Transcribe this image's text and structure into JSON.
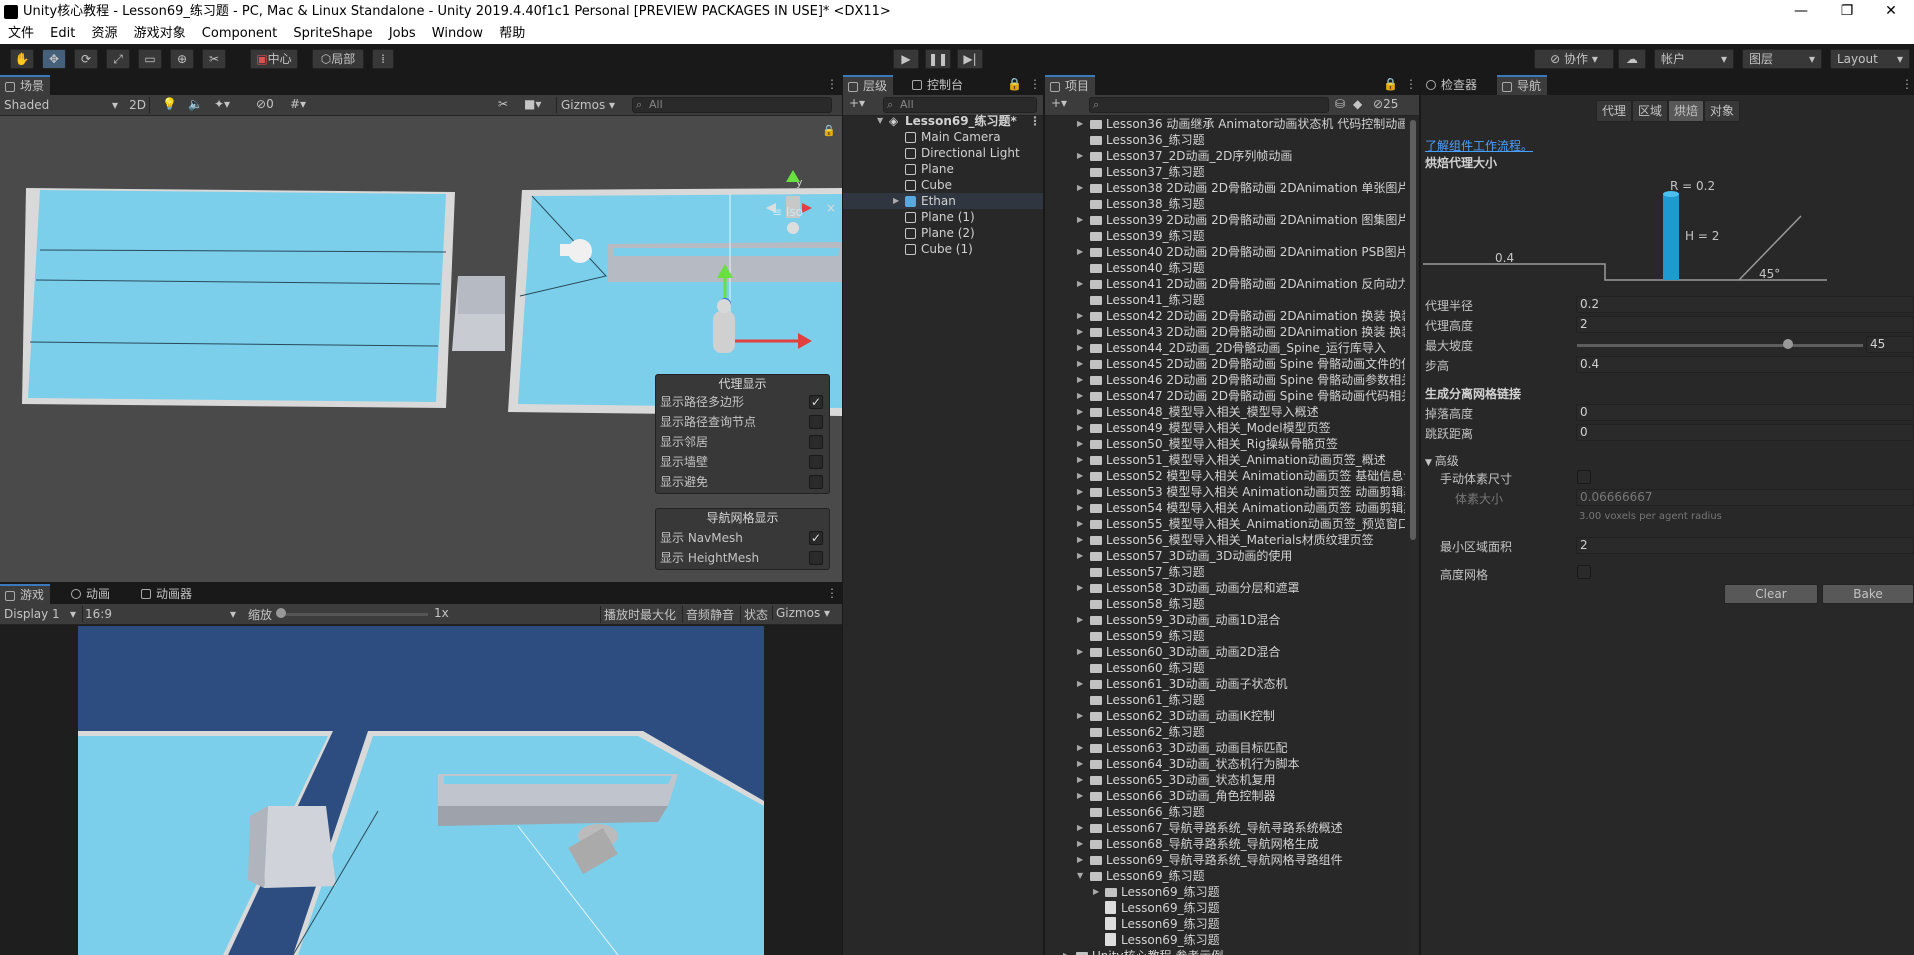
{
  "window": {
    "title": "Unity核心教程 - Lesson69_练习题 - PC, Mac & Linux Standalone - Unity 2019.4.40f1c1 Personal [PREVIEW PACKAGES IN USE]* <DX11>",
    "minimize": "—",
    "maximize": "❐",
    "close": "✕"
  },
  "menu": [
    "文件",
    "Edit",
    "资源",
    "游戏对象",
    "Component",
    "SpriteShape",
    "Jobs",
    "Window",
    "帮助"
  ],
  "toolbar": {
    "center_label": "中心",
    "local_label": "局部",
    "collab_label": "协作",
    "account_label": "帐户",
    "layers_label": "图层",
    "layout_label": "Layout"
  },
  "scene": {
    "tab": "场景",
    "shading": "Shaded",
    "mode2d": "2D",
    "hidden_count": "0",
    "gizmos": "Gizmos",
    "search": "All",
    "persp": "≡ Iso",
    "gizmo_y": "y"
  },
  "agent_overlay": {
    "title": "代理显示",
    "items": [
      {
        "label": "显示路径多边形",
        "checked": true
      },
      {
        "label": "显示路径查询节点",
        "checked": false
      },
      {
        "label": "显示邻居",
        "checked": false
      },
      {
        "label": "显示墙壁",
        "checked": false
      },
      {
        "label": "显示避免",
        "checked": false
      }
    ]
  },
  "navmesh_overlay": {
    "title": "导航网格显示",
    "items": [
      {
        "label": "显示 NavMesh",
        "checked": true
      },
      {
        "label": "显示 HeightMesh",
        "checked": false
      }
    ]
  },
  "game": {
    "tabs": [
      "游戏",
      "动画",
      "动画器"
    ],
    "display": "Display 1",
    "aspect": "16:9",
    "scale_label": "缩放",
    "scale_value": "1x",
    "maximize": "播放时最大化",
    "mute": "音频静音",
    "stats": "状态",
    "gizmos": "Gizmos"
  },
  "hierarchy": {
    "tabs": [
      "层级",
      "控制台"
    ],
    "search": "All",
    "root": "Lesson69_练习题*",
    "items": [
      "Main Camera",
      "Directional Light",
      "Plane",
      "Cube",
      "Ethan",
      "Plane (1)",
      "Plane (2)",
      "Cube (1)"
    ]
  },
  "project": {
    "tab": "项目",
    "hidden_count": "25",
    "items": [
      "Lesson36 动画继承 Animator动画状态机 代码控制动画",
      "Lesson36_练习题",
      "Lesson37_2D动画_2D序列帧动画",
      "Lesson37_练习题",
      "Lesson38 2D动画 2D骨骼动画 2DAnimation 单张图片",
      "Lesson38_练习题",
      "Lesson39 2D动画 2D骨骼动画 2DAnimation 图集图片",
      "Lesson39_练习题",
      "Lesson40 2D动画 2D骨骼动画 2DAnimation PSB图片",
      "Lesson40_练习题",
      "Lesson41 2D动画 2D骨骼动画 2DAnimation 反向动力",
      "Lesson41_练习题",
      "Lesson42 2D动画 2D骨骼动画 2DAnimation 换装 换装",
      "Lesson43 2D动画 2D骨骼动画 2DAnimation 换装 换装",
      "Lesson44_2D动画_2D骨骼动画_Spine_运行库导入",
      "Lesson45 2D动画 2D骨骼动画 Spine 骨骼动画文件的使",
      "Lesson46 2D动画 2D骨骼动画 Spine 骨骼动画参数相关",
      "Lesson47 2D动画 2D骨骼动画 Spine 骨骼动画代码相关",
      "Lesson48_模型导入相关_模型导入概述",
      "Lesson49_模型导入相关_Model模型页签",
      "Lesson50_模型导入相关_Rig操纵骨骼页签",
      "Lesson51_模型导入相关_Animation动画页签_概述",
      "Lesson52 模型导入相关 Animation动画页签 基础信息设",
      "Lesson53 模型导入相关 Animation动画页签 动画剪辑基",
      "Lesson54 模型导入相关 Animation动画页签 动画剪辑其",
      "Lesson55_模型导入相关_Animation动画页签_预览窗口",
      "Lesson56_模型导入相关_Materials材质纹理页签",
      "Lesson57_3D动画_3D动画的使用",
      "Lesson57_练习题",
      "Lesson58_3D动画_动画分层和遮罩",
      "Lesson58_练习题",
      "Lesson59_3D动画_动画1D混合",
      "Lesson59_练习题",
      "Lesson60_3D动画_动画2D混合",
      "Lesson60_练习题",
      "Lesson61_3D动画_动画子状态机",
      "Lesson61_练习题",
      "Lesson62_3D动画_动画IK控制",
      "Lesson62_练习题",
      "Lesson63_3D动画_动画目标匹配",
      "Lesson64_3D动画_状态机行为脚本",
      "Lesson65_3D动画_状态机复用",
      "Lesson66_3D动画_角色控制器",
      "Lesson66_练习题",
      "Lesson67_导航寻路系统_导航寻路系统概述",
      "Lesson68_导航寻路系统_导航网格生成",
      "Lesson69_导航寻路系统_导航网格寻路组件",
      "Lesson69_练习题"
    ],
    "children": [
      "Lesson69_练习题",
      "Lesson69_练习题",
      "Lesson69_练习题",
      "Lesson69_练习题"
    ],
    "footer": "Unity核心教程 参考示例"
  },
  "inspector": {
    "tabs": [
      "检查器",
      "导航"
    ],
    "nav_tabs": [
      "代理",
      "区域",
      "烘焙",
      "对象"
    ],
    "link": "了解组件工作流程。",
    "bake_header": "烘焙代理大小",
    "diagram": {
      "r": "R = 0.2",
      "h": "H = 2",
      "step": "0.4",
      "slope": "45°"
    },
    "fields": {
      "radius_label": "代理半径",
      "radius": "0.2",
      "height_label": "代理高度",
      "height": "2",
      "slope_label": "最大坡度",
      "slope": "45",
      "step_label": "步高",
      "step": "0.4"
    },
    "offmesh_header": "生成分离网格链接",
    "drop_label": "掉落高度",
    "drop": "0",
    "jump_label": "跳跃距离",
    "jump": "0",
    "advanced": "高级",
    "manual_voxel": "手动体素尺寸",
    "voxel_label": "体素大小",
    "voxel": "0.06666667",
    "voxel_hint": "3.00 voxels per agent radius",
    "min_region_label": "最小区域面积",
    "min_region": "2",
    "height_mesh": "高度网格",
    "clear": "Clear",
    "bake": "Bake"
  },
  "colors": {
    "accent": "#3a79bb",
    "navmesh": "#7ccfea",
    "link": "#4aa0ff"
  }
}
